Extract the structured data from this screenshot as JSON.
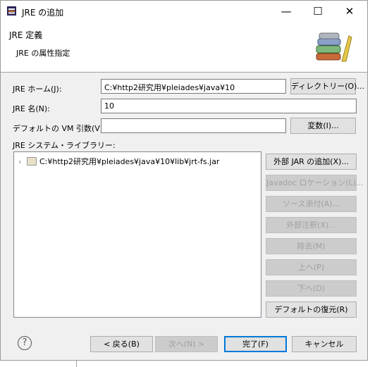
{
  "window": {
    "title": "JRE の追加",
    "minimize": "—",
    "maximize": "☐",
    "close": "✕"
  },
  "header": {
    "title": "JRE 定義",
    "subtitle": "JRE の属性指定"
  },
  "form": {
    "jre_home_label": "JRE ホーム(J):",
    "jre_home_value": "C:¥http2研究用¥pleiades¥java¥10",
    "directory_button": "ディレクトリー(O)...",
    "jre_name_label": "JRE 名(N):",
    "jre_name_value": "10",
    "vm_args_label": "デフォルトの VM 引数(V):",
    "vm_args_value": "",
    "variables_button": "変数(I)...",
    "libraries_label": "JRE システム・ライブラリー:"
  },
  "libraries": [
    {
      "path": "C:¥http2研究用¥pleiades¥java¥10¥lib¥jrt-fs.jar"
    }
  ],
  "library_buttons": {
    "add_external_jar": "外部 JAR の追加(X)...",
    "javadoc_location": "Javadoc ロケーション(L)...",
    "source_attachment": "ソース添付(A)...",
    "external_annotations": "外部注釈(X)...",
    "remove": "除去(M)",
    "up": "上へ(P)",
    "down": "下へ(D)",
    "restore_default": "デフォルトの復元(R)"
  },
  "footer": {
    "help": "?",
    "back": "< 戻る(B)",
    "next": "次へ(N) >",
    "finish": "完了(F)",
    "cancel": "キャンセル"
  }
}
